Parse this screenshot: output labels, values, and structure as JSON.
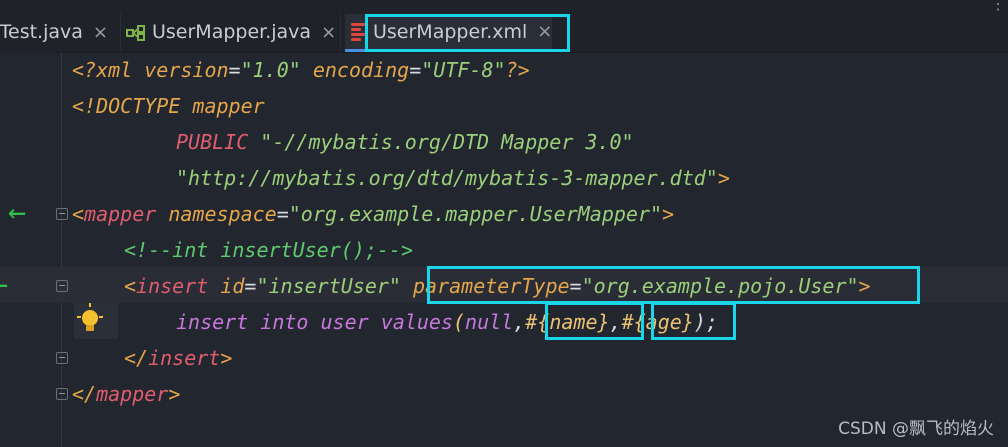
{
  "tabs": [
    {
      "label": "oTest.java",
      "close": "×"
    },
    {
      "label": "UserMapper.java",
      "close": "×"
    },
    {
      "label": "UserMapper.xml",
      "close": "×",
      "active": true
    }
  ],
  "window_controls": "⋮",
  "code": {
    "l1": {
      "a": "<?xml ",
      "b": "version",
      "c": "=",
      "d": "\"1.0\"",
      "e": " encoding",
      "f": "=",
      "g": "\"UTF-8\"",
      "h": "?>"
    },
    "l2": {
      "a": "<!DOCTYPE ",
      "b": "mapper"
    },
    "l3": {
      "a": "PUBLIC ",
      "b": "\"-//mybatis.org/DTD Mapper 3.0\""
    },
    "l4": {
      "a": "\"http://mybatis.org/dtd/mybatis-3-mapper.dtd\"",
      "b": ">"
    },
    "l5": {
      "a": "<",
      "b": "mapper",
      "c": " namespace",
      "d": "=",
      "e": "\"org.example.mapper.UserMapper\"",
      "f": ">"
    },
    "l6": {
      "a": "<!--int insertUser();-->"
    },
    "l7": {
      "a": "<",
      "b": "insert",
      "c": " id",
      "d": "=",
      "e": "\"insertUser\"",
      "f": " parameterType",
      "g": "=",
      "h": "\"org.example.pojo.User\"",
      "i": ">"
    },
    "l8": {
      "a": "insert",
      "b": " into",
      "c": " user",
      "d": " values",
      "e": "(",
      "f": "null",
      "g": ",",
      "h": "#{name}",
      "i": ",",
      "j": "#{age}",
      "k": ");"
    },
    "l9": {
      "a": "</",
      "b": "insert",
      "c": ">"
    },
    "l10": {
      "a": "</",
      "b": "mapper",
      "c": ">"
    }
  },
  "gutter_icons": [
    "arrow-left-icon",
    "arrow-left-icon",
    "lightbulb-icon"
  ],
  "watermark": "CSDN @飘飞的焰火",
  "colors": {
    "highlight": "#1ad6ea",
    "tag": "#e05d6f",
    "attr": "#e5a64b",
    "string": "#9bcf7a",
    "comment": "#5fc96f",
    "keyword": "#c678dd"
  }
}
